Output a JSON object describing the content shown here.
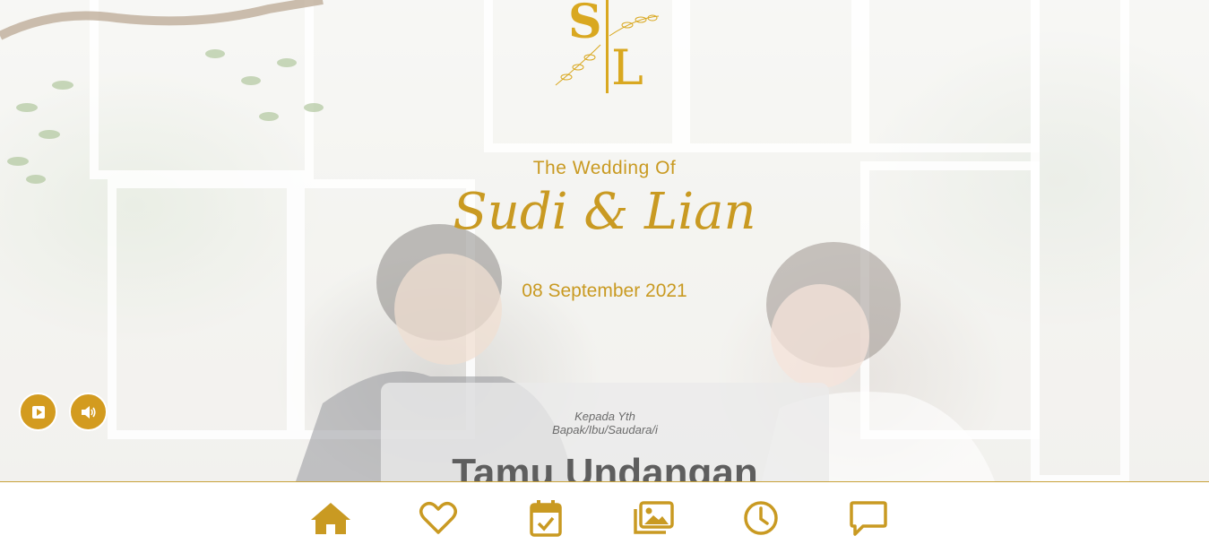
{
  "logo": {
    "initial_left": "S",
    "initial_right": "L"
  },
  "hero": {
    "subtitle": "The Wedding Of",
    "couple_names": "Sudi & Lian",
    "date": "08 September 2021"
  },
  "audio_controls": {
    "play_icon": "play-icon",
    "volume_icon": "volume-icon",
    "accent_color": "#d39b1f"
  },
  "invitation_card": {
    "to_line1": "Kepada Yth",
    "to_line2": "Bapak/Ibu/Saudara/i",
    "guest_name": "Tamu Undangan"
  },
  "navbar": {
    "accent_color": "#c99a22",
    "items": [
      {
        "icon": "home-icon"
      },
      {
        "icon": "heart-icon"
      },
      {
        "icon": "calendar-check-icon"
      },
      {
        "icon": "gallery-icon"
      },
      {
        "icon": "clock-icon"
      },
      {
        "icon": "chat-icon"
      }
    ]
  }
}
